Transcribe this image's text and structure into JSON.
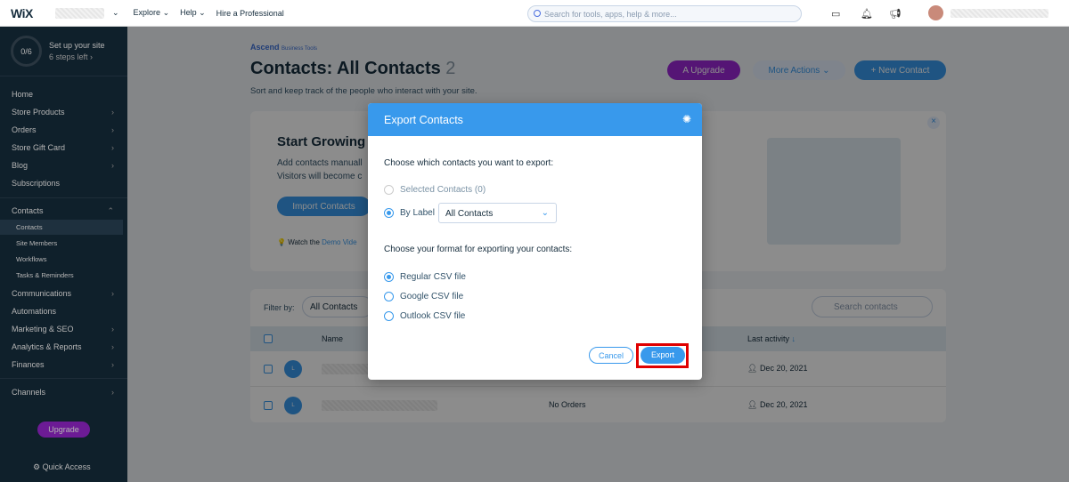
{
  "topbar": {
    "logo": "WiX",
    "nav": [
      "Explore",
      "Help",
      "Hire a Professional"
    ],
    "search_placeholder": "Search for tools, apps, help & more..."
  },
  "sidebar": {
    "progress": "0/6",
    "setup_title": "Set up your site",
    "setup_sub": "6 steps left ›",
    "items": [
      {
        "label": "Home",
        "chev": false
      },
      {
        "label": "Store Products",
        "chev": true
      },
      {
        "label": "Orders",
        "chev": true
      },
      {
        "label": "Store Gift Card",
        "chev": true
      },
      {
        "label": "Blog",
        "chev": true
      },
      {
        "label": "Subscriptions",
        "chev": false
      }
    ],
    "contacts": "Contacts",
    "sub_items": [
      "Contacts",
      "Site Members",
      "Workflows",
      "Tasks & Reminders"
    ],
    "items2": [
      "Communications",
      "Automations",
      "Marketing & SEO",
      "Analytics & Reports",
      "Finances"
    ],
    "channels": "Channels",
    "upgrade": "Upgrade",
    "quick_access": "Quick Access"
  },
  "page": {
    "brand": "Ascend",
    "brand_sub": "Business Tools",
    "title": "Contacts: All Contacts",
    "count": "2",
    "subtitle": "Sort and keep track of the people who interact with your site.",
    "upgrade": "Upgrade",
    "more_actions": "More Actions",
    "new_contact": "+ New Contact",
    "banner_title": "Start Growing",
    "banner_text1": "Add contacts manuall",
    "banner_text2": "Visitors will become c",
    "import": "Import Contacts",
    "watch": "Watch the",
    "demo": "Demo Vide",
    "filter_label": "Filter by:",
    "filter_value": "All Contacts",
    "search_contacts": "Search contacts",
    "columns": {
      "name": "Name",
      "last_activity": "Last activity"
    },
    "rows": [
      {
        "initial": "L",
        "orders": "",
        "date": "Dec 20, 2021"
      },
      {
        "initial": "L",
        "orders": "No Orders",
        "date": "Dec 20, 2021"
      }
    ]
  },
  "modal": {
    "title": "Export Contacts",
    "q1": "Choose which contacts you want to export:",
    "opt_selected": "Selected Contacts (0)",
    "opt_label": "By Label",
    "label_value": "All Contacts",
    "q2": "Choose your format for exporting your contacts:",
    "formats": [
      "Regular CSV file",
      "Google CSV file",
      "Outlook CSV file"
    ],
    "cancel": "Cancel",
    "export": "Export"
  }
}
